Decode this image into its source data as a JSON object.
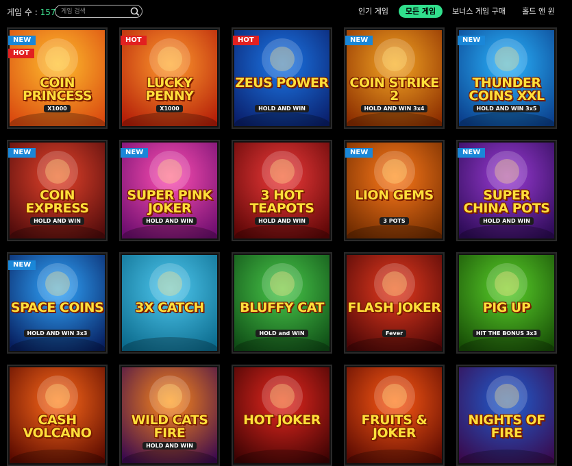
{
  "header": {
    "count_label": "게임 수 :",
    "count_value": "157",
    "search_placeholder": "게임 검색",
    "tabs": [
      {
        "label": "인기 게임",
        "active": false
      },
      {
        "label": "모든 게임",
        "active": true
      },
      {
        "label": "보너스 게임 구매",
        "active": false
      },
      {
        "label": "홀드 앤 윈",
        "active": false
      }
    ]
  },
  "colors": {
    "accent": "#31e08d",
    "badge_new": "#1a87d8",
    "badge_hot": "#e22020"
  },
  "games": [
    {
      "title": "Coin Princess",
      "subtitle": "X1000",
      "badges": [
        "NEW",
        "HOT"
      ],
      "bg": [
        "#ffbe2e",
        "#d9480f"
      ]
    },
    {
      "title": "Lucky Penny",
      "subtitle": "X1000",
      "badges": [
        "HOT"
      ],
      "bg": [
        "#ff9b2e",
        "#b31d08"
      ]
    },
    {
      "title": "Zeus Power",
      "subtitle": "HOLD AND WIN",
      "badges": [
        "HOT"
      ],
      "bg": [
        "#1c78e8",
        "#0a1f6b"
      ]
    },
    {
      "title": "Coin Strike 2",
      "subtitle": "HOLD AND WIN 3x4",
      "badges": [
        "NEW"
      ],
      "bg": [
        "#f5a623",
        "#8a2c00"
      ]
    },
    {
      "title": "Thunder Coins XXL",
      "subtitle": "HOLD AND WIN 3x5",
      "badges": [
        "NEW"
      ],
      "bg": [
        "#2ab6ff",
        "#0b3f8c"
      ]
    },
    {
      "title": "Coin Express",
      "subtitle": "HOLD AND WIN",
      "badges": [
        "NEW"
      ],
      "bg": [
        "#e6432b",
        "#4f0b0b"
      ]
    },
    {
      "title": "Super Pink Joker",
      "subtitle": "HOLD AND WIN",
      "badges": [
        "NEW"
      ],
      "bg": [
        "#ff4fb2",
        "#6b0d6e"
      ]
    },
    {
      "title": "3 Hot Teapots",
      "subtitle": "HOLD AND WIN",
      "badges": [],
      "bg": [
        "#f03a3a",
        "#5c0606"
      ]
    },
    {
      "title": "Lion Gems",
      "subtitle": "3 POTS",
      "badges": [
        "NEW"
      ],
      "bg": [
        "#ff7a1a",
        "#6d2a00"
      ]
    },
    {
      "title": "Super China Pots",
      "subtitle": "HOLD AND WIN",
      "badges": [
        "NEW"
      ],
      "bg": [
        "#9a3bd4",
        "#2c0b55"
      ]
    },
    {
      "title": "Space Coins",
      "subtitle": "HOLD AND WIN 3x3",
      "badges": [
        "NEW"
      ],
      "bg": [
        "#31a8ff",
        "#071e5e"
      ]
    },
    {
      "title": "3x Catch",
      "subtitle": "",
      "badges": [],
      "bg": [
        "#4fc9f0",
        "#0b6a8c"
      ]
    },
    {
      "title": "Bluffy Cat",
      "subtitle": "HOLD and WIN",
      "badges": [],
      "bg": [
        "#49c94a",
        "#0f4d16"
      ]
    },
    {
      "title": "Flash Joker",
      "subtitle": "Fever",
      "badges": [],
      "bg": [
        "#e83b1f",
        "#4a0606"
      ]
    },
    {
      "title": "Pig Up",
      "subtitle": "HIT THE BONUS 3x3",
      "badges": [],
      "bg": [
        "#5ad12a",
        "#174d06"
      ]
    },
    {
      "title": "Cash Volcano",
      "subtitle": "",
      "badges": [],
      "bg": [
        "#ff6a1a",
        "#5a0a00"
      ]
    },
    {
      "title": "Wild Cats Fire",
      "subtitle": "HOLD AND WIN",
      "badges": [],
      "bg": [
        "#ff8a1a",
        "#3b0a4d"
      ]
    },
    {
      "title": "Hot Joker",
      "subtitle": "",
      "badges": [],
      "bg": [
        "#e8281f",
        "#3d0303"
      ]
    },
    {
      "title": "Fruits & Joker",
      "subtitle": "",
      "badges": [],
      "bg": [
        "#ff5a14",
        "#5a0a02"
      ]
    },
    {
      "title": "Nights of Fire",
      "subtitle": "",
      "badges": [],
      "bg": [
        "#1f5fd1",
        "#3a0a4d"
      ]
    }
  ]
}
